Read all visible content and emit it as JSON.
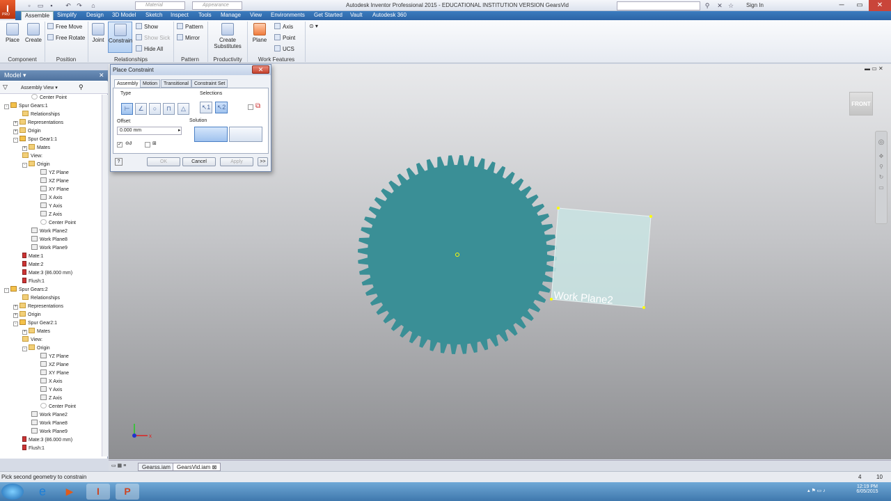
{
  "app": {
    "window_title": "Autodesk Inventor Professional 2015 - EDUCATIONAL INSTITUTION VERSION    GearsVid",
    "app_badge": "I",
    "app_badge_sub": "PRO",
    "material_placeholder": "Material",
    "appearance_placeholder": "Appearance",
    "sign_in": "Sign In"
  },
  "menu": {
    "tabs": [
      "Assemble",
      "Simplify",
      "Design",
      "3D Model",
      "Sketch",
      "Inspect",
      "Tools",
      "Manage",
      "View",
      "Environments",
      "Get Started",
      "Vault",
      "Autodesk 360"
    ]
  },
  "ribbon": {
    "place": "Place",
    "create": "Create",
    "free_move": "Free Move",
    "free_rotate": "Free Rotate",
    "joint": "Joint",
    "constrain": "Constrain",
    "show": "Show",
    "show_sick": "Show Sick",
    "hide_all": "Hide All",
    "pattern": "Pattern",
    "mirror": "Mirror",
    "create_substitutes_1": "Create",
    "create_substitutes_2": "Substitutes",
    "plane": "Plane",
    "axis": "Axis",
    "point": "Point",
    "ucs": "UCS",
    "groups": {
      "component": "Component",
      "position": "Position",
      "relationships": "Relationships",
      "pattern": "Pattern",
      "productivity": "Productivity",
      "work_features": "Work Features"
    }
  },
  "browser": {
    "title": "Model",
    "view": "Assembly View",
    "tree": [
      {
        "label": "Center Point",
        "indent": 3,
        "icon": "pt"
      },
      {
        "label": "Spur Gears:1",
        "indent": 0,
        "icon": "asm",
        "ex": "-"
      },
      {
        "label": "Relationships",
        "indent": 2,
        "icon": "fold"
      },
      {
        "label": "Representations",
        "indent": 1,
        "icon": "fold",
        "ex": "+"
      },
      {
        "label": "Origin",
        "indent": 1,
        "icon": "fold",
        "ex": "+"
      },
      {
        "label": "Spur Gear1:1",
        "indent": 1,
        "icon": "asm",
        "ex": "-"
      },
      {
        "label": "Mates",
        "indent": 2,
        "icon": "fold",
        "ex": "+"
      },
      {
        "label": "View:",
        "indent": 2,
        "icon": "fold"
      },
      {
        "label": "Origin",
        "indent": 2,
        "icon": "fold",
        "ex": "-"
      },
      {
        "label": "YZ Plane",
        "indent": 4,
        "icon": "plane"
      },
      {
        "label": "XZ Plane",
        "indent": 4,
        "icon": "plane"
      },
      {
        "label": "XY Plane",
        "indent": 4,
        "icon": "plane"
      },
      {
        "label": "X Axis",
        "indent": 4,
        "icon": "plane"
      },
      {
        "label": "Y Axis",
        "indent": 4,
        "icon": "plane"
      },
      {
        "label": "Z Axis",
        "indent": 4,
        "icon": "plane"
      },
      {
        "label": "Center Point",
        "indent": 4,
        "icon": "pt"
      },
      {
        "label": "Work Plane2",
        "indent": 3,
        "icon": "plane"
      },
      {
        "label": "Work Plane8",
        "indent": 3,
        "icon": "plane"
      },
      {
        "label": "Work Plane9",
        "indent": 3,
        "icon": "plane"
      },
      {
        "label": "Mate:1",
        "indent": 2,
        "icon": "mate"
      },
      {
        "label": "Mate:2",
        "indent": 2,
        "icon": "mate"
      },
      {
        "label": "Mate:3 (86.000 mm)",
        "indent": 2,
        "icon": "mate"
      },
      {
        "label": "Flush:1",
        "indent": 2,
        "icon": "mate"
      },
      {
        "label": "Spur Gears:2",
        "indent": 0,
        "icon": "asm",
        "ex": "-"
      },
      {
        "label": "Relationships",
        "indent": 2,
        "icon": "fold"
      },
      {
        "label": "Representations",
        "indent": 1,
        "icon": "fold",
        "ex": "+"
      },
      {
        "label": "Origin",
        "indent": 1,
        "icon": "fold",
        "ex": "+"
      },
      {
        "label": "Spur Gear2:1",
        "indent": 1,
        "icon": "asm",
        "ex": "-"
      },
      {
        "label": "Mates",
        "indent": 2,
        "icon": "fold",
        "ex": "+"
      },
      {
        "label": "View:",
        "indent": 2,
        "icon": "fold"
      },
      {
        "label": "Origin",
        "indent": 2,
        "icon": "fold",
        "ex": "-"
      },
      {
        "label": "YZ Plane",
        "indent": 4,
        "icon": "plane"
      },
      {
        "label": "XZ Plane",
        "indent": 4,
        "icon": "plane"
      },
      {
        "label": "XY Plane",
        "indent": 4,
        "icon": "plane"
      },
      {
        "label": "X Axis",
        "indent": 4,
        "icon": "plane"
      },
      {
        "label": "Y Axis",
        "indent": 4,
        "icon": "plane"
      },
      {
        "label": "Z Axis",
        "indent": 4,
        "icon": "plane"
      },
      {
        "label": "Center Point",
        "indent": 4,
        "icon": "pt"
      },
      {
        "label": "Work Plane2",
        "indent": 3,
        "icon": "plane"
      },
      {
        "label": "Work Plane8",
        "indent": 3,
        "icon": "plane"
      },
      {
        "label": "Work Plane9",
        "indent": 3,
        "icon": "plane"
      },
      {
        "label": "Mate:3 (86.000 mm)",
        "indent": 2,
        "icon": "mate"
      },
      {
        "label": "Flush:1",
        "indent": 2,
        "icon": "mate"
      }
    ]
  },
  "dialog": {
    "title": "Place Constraint",
    "tabs": [
      "Assembly",
      "Motion",
      "Transitional",
      "Constraint Set"
    ],
    "type_label": "Type",
    "selections_label": "Selections",
    "offset_label": "Offset:",
    "offset_value": "0.000 mm",
    "solution_label": "Solution",
    "ok": "OK",
    "cancel": "Cancel",
    "apply": "Apply",
    "more": ">>"
  },
  "viewport": {
    "workplane_label": "Work Plane2",
    "viewcube_label": "FRONT",
    "gear_color": "#3a8f96",
    "plane_color": "#c9e4e3"
  },
  "docs": {
    "tabs": [
      "Gearss.iam",
      "GearsVid.iam"
    ]
  },
  "status": {
    "message": "Pick second geometry to constrain",
    "count1": "4",
    "count2": "10"
  },
  "taskbar": {
    "time": "12:19 PM",
    "date": "6/05/2015"
  }
}
